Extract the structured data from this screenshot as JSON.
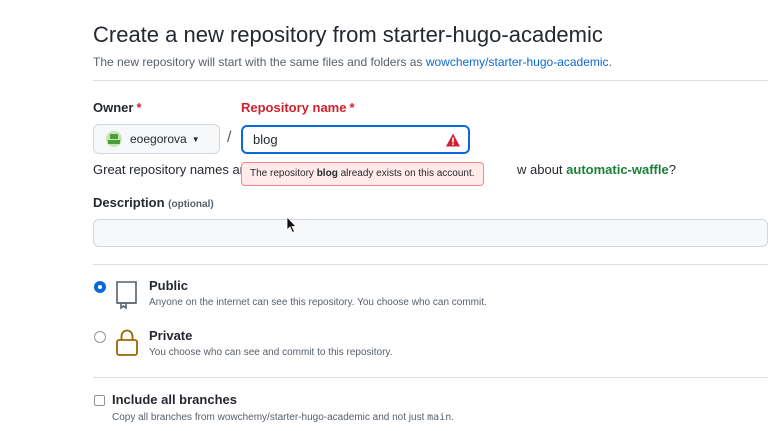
{
  "header": {
    "title": "Create a new repository from starter-hugo-academic",
    "subtitle_prefix": "The new repository will start with the same files and folders as ",
    "template_link": "wowchemy/starter-hugo-academic",
    "subtitle_suffix": "."
  },
  "owner": {
    "label": "Owner",
    "required_mark": "*",
    "selected": "eoegorova",
    "caret_icon": "triangle-down-icon"
  },
  "separator": "/",
  "repo_name": {
    "label": "Repository name",
    "required_mark": "*",
    "value": "blog",
    "state": "error",
    "status_icon": "alert-triangle-icon"
  },
  "hint": {
    "prefix": "Great repository names ar",
    "suffix_before": "w about ",
    "suggestion": "automatic-waffle",
    "suffix_after": "?"
  },
  "error_tooltip": {
    "prefix": "The repository ",
    "name": "blog",
    "suffix": " already exists on this account."
  },
  "description": {
    "label": "Description",
    "optional_tag": "(optional)",
    "value": ""
  },
  "visibility": {
    "selected": "public",
    "options": [
      {
        "id": "public",
        "title": "Public",
        "description": "Anyone on the internet can see this repository. You choose who can commit.",
        "icon": "repo-icon"
      },
      {
        "id": "private",
        "title": "Private",
        "description": "You choose who can see and commit to this repository.",
        "icon": "lock-icon"
      }
    ]
  },
  "branches": {
    "title": "Include all branches",
    "checked": false,
    "description_prefix": "Copy all branches from wowchemy/starter-hugo-academic and not just ",
    "description_code": "main",
    "description_suffix": "."
  },
  "colors": {
    "accent": "#0969da",
    "error": "#cf222e",
    "error_bg": "#ffebe9",
    "suggestion": "#1a7f37"
  }
}
